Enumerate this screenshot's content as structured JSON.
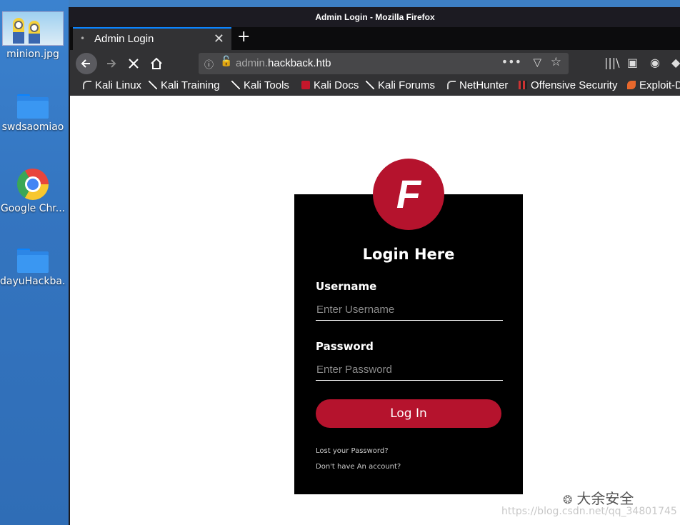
{
  "desktop": {
    "icons": [
      {
        "label": "minion.jpg"
      },
      {
        "label": "swdsaomiao"
      },
      {
        "label": "Google Chr..."
      },
      {
        "label": "dayuHackba..."
      }
    ]
  },
  "window": {
    "title": "Admin Login - Mozilla Firefox",
    "tab": {
      "label": "Admin Login",
      "close": "✕",
      "dot": "•"
    },
    "new_tab": "+",
    "url": {
      "prefix": "admin.",
      "domain": "hackback.htb"
    },
    "bookmarks": [
      {
        "label": "Kali Linux"
      },
      {
        "label": "Kali Training"
      },
      {
        "label": "Kali Tools"
      },
      {
        "label": "Kali Docs"
      },
      {
        "label": "Kali Forums"
      },
      {
        "label": "NetHunter"
      },
      {
        "label": "Offensive Security"
      },
      {
        "label": "Exploit-D"
      }
    ]
  },
  "page": {
    "logo_letter": "F",
    "title": "Login Here",
    "username_label": "Username",
    "username_placeholder": "Enter Username",
    "password_label": "Password",
    "password_placeholder": "Enter Password",
    "login_button": "Log In",
    "lost_password": "Lost your Password?",
    "no_account": "Don't have An account?"
  },
  "watermark": {
    "brand": "大余安全",
    "url": "https://blog.csdn.net/qq_34801745"
  },
  "colors": {
    "accent": "#b5132d",
    "tab_highlight": "#0a84ff"
  }
}
